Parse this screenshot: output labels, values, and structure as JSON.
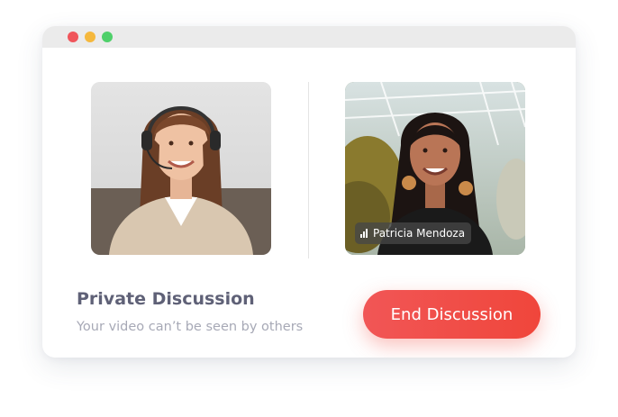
{
  "window": {
    "controls": [
      "close",
      "minimize",
      "maximize"
    ]
  },
  "participants": [
    {
      "role": "self-video",
      "name": ""
    },
    {
      "role": "remote-video",
      "name": "Patricia Mendoza",
      "signal_icon": "signal-bars-icon"
    }
  ],
  "footer": {
    "title": "Private Discussion",
    "subtitle": "Your video can’t be seen by others",
    "end_button_label": "End Discussion"
  },
  "colors": {
    "accent": "#f0463b",
    "title_text": "#5f6177",
    "subtitle_text": "#a7a9b6"
  }
}
